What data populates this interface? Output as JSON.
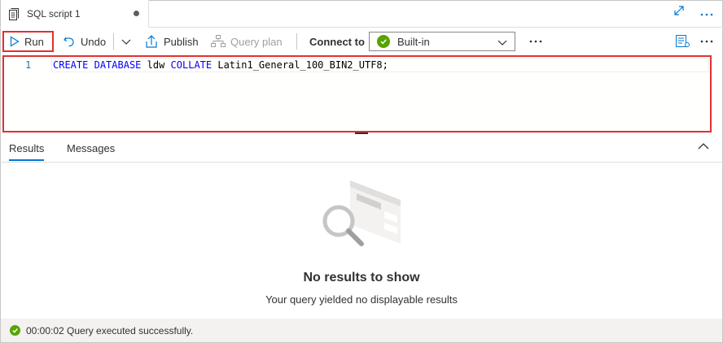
{
  "tab": {
    "title": "SQL script 1"
  },
  "toolbar": {
    "run_label": "Run",
    "undo_label": "Undo",
    "publish_label": "Publish",
    "query_plan_label": "Query plan",
    "connect_to_label": "Connect to",
    "connection_value": "Built-in"
  },
  "editor": {
    "line_number": "1",
    "tokens": {
      "kw1": "CREATE",
      "kw2": "DATABASE",
      "name": "ldw",
      "kw3": "COLLATE",
      "collation": "Latin1_General_100_BIN2_UTF8;"
    }
  },
  "results": {
    "tabs": [
      "Results",
      "Messages"
    ],
    "empty_title": "No results to show",
    "empty_subtitle": "Your query yielded no displayable results"
  },
  "status": {
    "message": "00:00:02 Query executed successfully."
  },
  "colors": {
    "accent": "#0078d4",
    "highlight_border": "#e0312f",
    "success": "#57a300"
  },
  "icons": [
    "document-icon",
    "unsaved-dot-icon",
    "expand-icon",
    "more-icon",
    "play-icon",
    "undo-icon",
    "chevron-down-icon",
    "publish-icon",
    "query-plan-icon",
    "check-circle-icon",
    "properties-icon",
    "chevron-up-icon",
    "empty-results-illustration"
  ]
}
